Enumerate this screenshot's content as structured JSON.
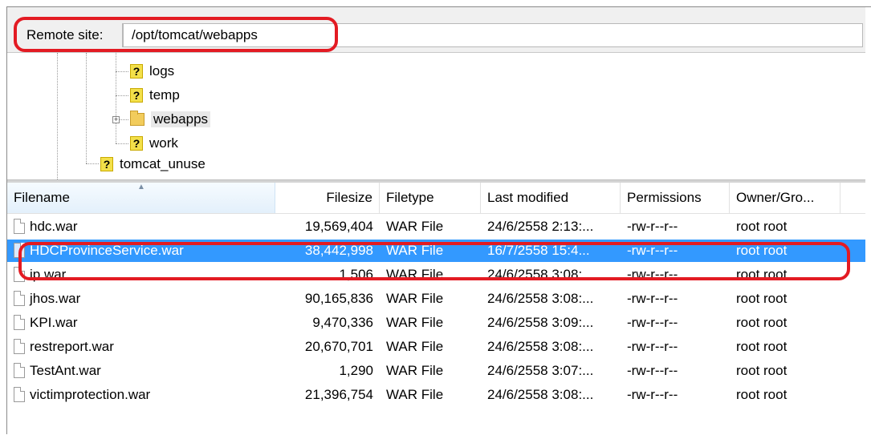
{
  "remote_site": {
    "label": "Remote site:",
    "path": "/opt/tomcat/webapps"
  },
  "tree": {
    "items": [
      {
        "label": "logs",
        "icon": "question-icon"
      },
      {
        "label": "temp",
        "icon": "question-icon"
      },
      {
        "label": "webapps",
        "icon": "folder-icon",
        "expandable": true,
        "selected": true
      },
      {
        "label": "work",
        "icon": "question-icon"
      },
      {
        "label": "tomcat_unuse",
        "icon": "question-icon"
      }
    ]
  },
  "file_list": {
    "columns": [
      "Filename",
      "Filesize",
      "Filetype",
      "Last modified",
      "Permissions",
      "Owner/Gro..."
    ],
    "rows": [
      {
        "name": "hdc.war",
        "size": "19,569,404",
        "type": "WAR File",
        "modified": "24/6/2558 2:13:...",
        "perms": "-rw-r--r--",
        "owner": "root root"
      },
      {
        "name": "HDCProvinceService.war",
        "size": "38,442,998",
        "type": "WAR File",
        "modified": "16/7/2558 15:4...",
        "perms": "-rw-r--r--",
        "owner": "root root"
      },
      {
        "name": "ip.war",
        "size": "1,506",
        "type": "WAR File",
        "modified": "24/6/2558 3:08:...",
        "perms": "-rw-r--r--",
        "owner": "root root"
      },
      {
        "name": "jhos.war",
        "size": "90,165,836",
        "type": "WAR File",
        "modified": "24/6/2558 3:08:...",
        "perms": "-rw-r--r--",
        "owner": "root root"
      },
      {
        "name": "KPI.war",
        "size": "9,470,336",
        "type": "WAR File",
        "modified": "24/6/2558 3:09:...",
        "perms": "-rw-r--r--",
        "owner": "root root"
      },
      {
        "name": "restreport.war",
        "size": "20,670,701",
        "type": "WAR File",
        "modified": "24/6/2558 3:08:...",
        "perms": "-rw-r--r--",
        "owner": "root root"
      },
      {
        "name": "TestAnt.war",
        "size": "1,290",
        "type": "WAR File",
        "modified": "24/6/2558 3:07:...",
        "perms": "-rw-r--r--",
        "owner": "root root"
      },
      {
        "name": "victimprotection.war",
        "size": "21,396,754",
        "type": "WAR File",
        "modified": "24/6/2558 3:08:...",
        "perms": "-rw-r--r--",
        "owner": "root root"
      }
    ],
    "selected_index": 1
  },
  "colors": {
    "highlight": "#e31b23",
    "selection": "#3399ff"
  }
}
